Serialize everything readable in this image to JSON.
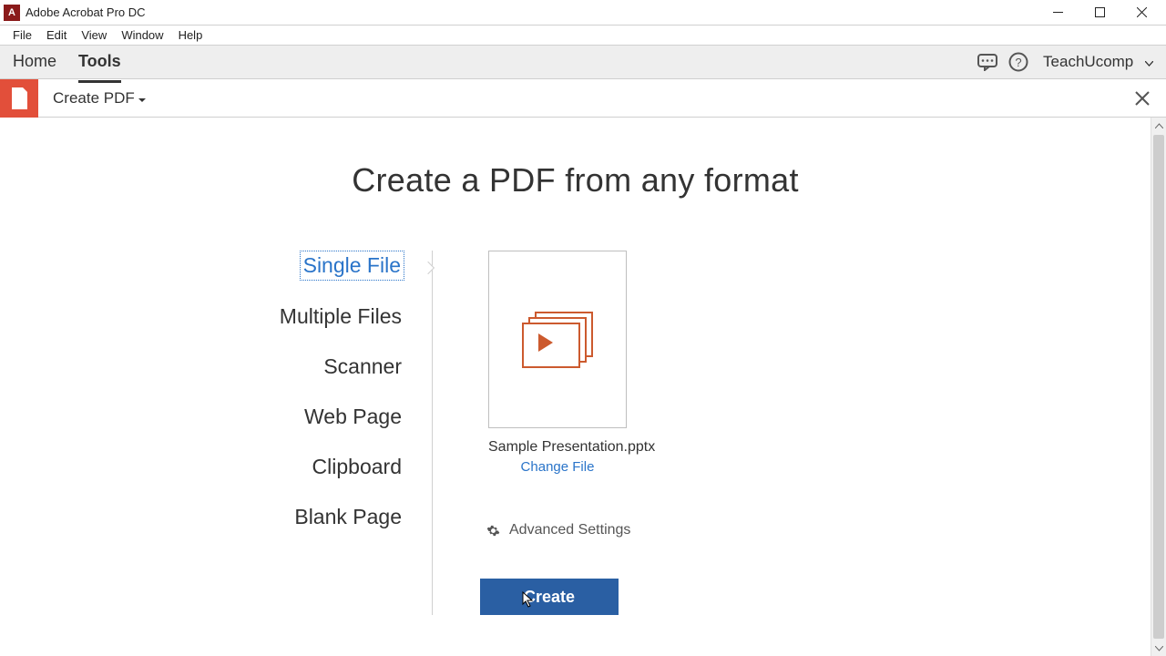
{
  "window": {
    "title": "Adobe Acrobat Pro DC"
  },
  "menubar": [
    "File",
    "Edit",
    "View",
    "Window",
    "Help"
  ],
  "navbar": {
    "items": [
      "Home",
      "Tools"
    ],
    "active_index": 1,
    "username": "TeachUcomp"
  },
  "tool_header": {
    "title": "Create PDF"
  },
  "page": {
    "heading": "Create a PDF from any format",
    "sources": [
      "Single File",
      "Multiple Files",
      "Scanner",
      "Web Page",
      "Clipboard",
      "Blank Page"
    ],
    "active_source_index": 0,
    "selected_file": "Sample Presentation.pptx",
    "change_file_label": "Change File",
    "advanced_label": "Advanced Settings",
    "create_label": "Create"
  }
}
